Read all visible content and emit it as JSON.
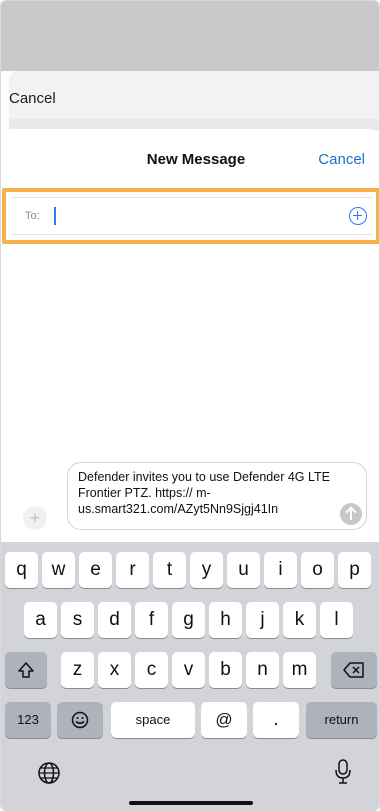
{
  "background_sheet": {
    "cancel_label": "Cancel"
  },
  "compose": {
    "title": "New Message",
    "cancel_label": "Cancel",
    "to_label": "To:",
    "to_value": "",
    "add_contact_icon": "plus-circle-icon",
    "message_text": "Defender invites you to use Defender 4G LTE Frontier PTZ. https:// m-us.smart321.com/AZyt5Nn9Sjgj41In",
    "attach_icon": "plus-icon",
    "send_icon": "arrow-up-icon"
  },
  "keyboard": {
    "row1": [
      "q",
      "w",
      "e",
      "r",
      "t",
      "y",
      "u",
      "i",
      "o",
      "p"
    ],
    "row2": [
      "a",
      "s",
      "d",
      "f",
      "g",
      "h",
      "j",
      "k",
      "l"
    ],
    "row3": [
      "z",
      "x",
      "c",
      "v",
      "b",
      "n",
      "m"
    ],
    "shift_icon": "shift-icon",
    "delete_icon": "backspace-icon",
    "numbers_label": "123",
    "emoji_icon": "emoji-icon",
    "space_label": "space",
    "at_label": "@",
    "period_label": ".",
    "return_label": "return",
    "globe_icon": "globe-icon",
    "mic_icon": "microphone-icon"
  },
  "colors": {
    "accent": "#1f6fd1",
    "highlight": "#f4b24a",
    "keyboard_bg": "#d2d4da"
  }
}
